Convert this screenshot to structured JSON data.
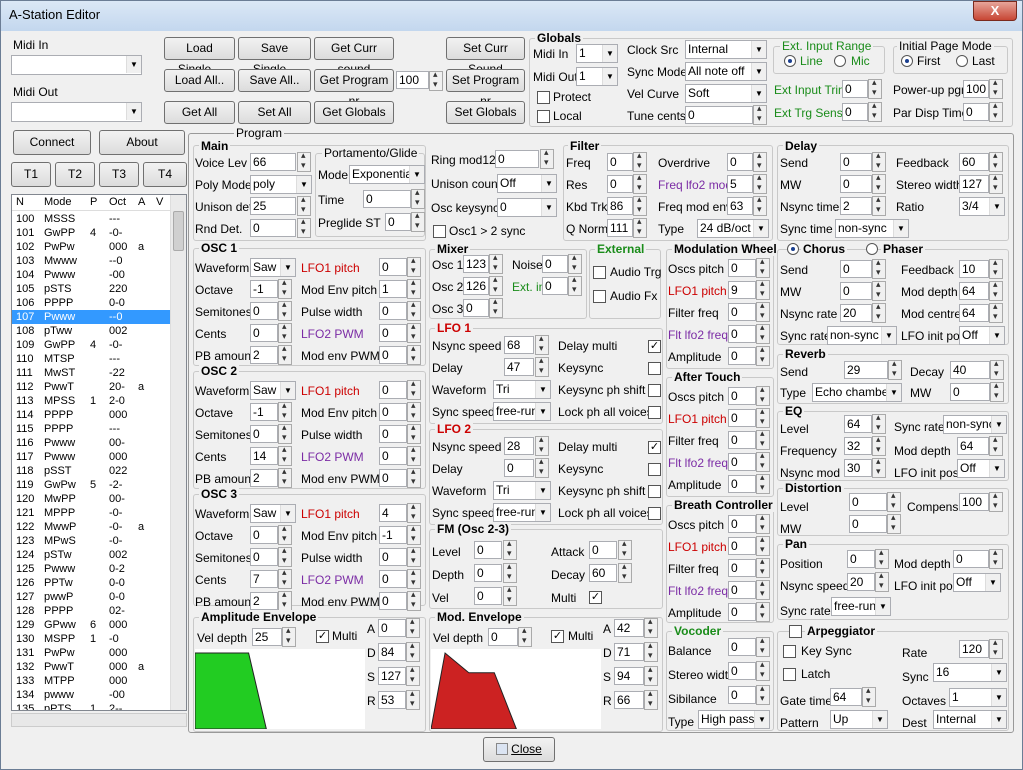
{
  "window": {
    "title": "A-Station Editor",
    "close_glyph": "X"
  },
  "midi": {
    "in_label": "Midi In",
    "out_label": "Midi Out",
    "in_value": "",
    "out_value": ""
  },
  "buttons": {
    "load_single": "Load Single...",
    "save_single": "Save Single...",
    "get_curr_sound": "Get Curr sound",
    "set_curr_sound": "Set Curr Sound",
    "load_all": "Load All..",
    "save_all": "Save All..",
    "get_program_nr": "Get Program nr",
    "program_nr_value": "100",
    "set_program_nr": "Set Program nr",
    "get_all": "Get All",
    "set_all": "Set All",
    "get_globals": "Get Globals",
    "set_globals": "Set Globals",
    "connect": "Connect",
    "about": "About",
    "t1": "T1",
    "t2": "T2",
    "t3": "T3",
    "t4": "T4",
    "close": "Close"
  },
  "globals": {
    "title": "Globals",
    "midi_in_label": "Midi In",
    "midi_in": "1",
    "midi_out_label": "Midi Out",
    "midi_out": "1",
    "protect": "Protect",
    "local": "Local",
    "clock_src_label": "Clock Src",
    "clock_src": "Internal",
    "sync_mode_label": "Sync Mode",
    "sync_mode": "All note off",
    "vel_curve_label": "Vel Curve",
    "vel_curve": "Soft",
    "tune_cents_label": "Tune cents",
    "tune_cents": "0",
    "ext_input_range": "Ext. Input Range",
    "line": "Line",
    "mic": "Mic",
    "ext_input_trim_label": "Ext Input Trim",
    "ext_input_trim": "0",
    "ext_trg_sens_label": "Ext Trg Sens",
    "ext_trg_sens": "0",
    "initial_page_mode": "Initial Page Mode",
    "first": "First",
    "last": "Last",
    "powerup_pgm_label": "Power-up pgm",
    "powerup_pgm": "100",
    "par_disp_time_label": "Par Disp Time",
    "par_disp_time": "0"
  },
  "program_label": "Program",
  "list": {
    "headers": [
      "N",
      "Mode",
      "P",
      "Oct",
      "A",
      "V"
    ],
    "rows": [
      [
        "100",
        "MSSS",
        "",
        "---",
        "",
        ""
      ],
      [
        "101",
        "GwPP",
        "4",
        "-0-",
        "",
        ""
      ],
      [
        "102",
        "PwPw",
        "",
        "000",
        "a",
        ""
      ],
      [
        "103",
        "Mwww",
        "",
        "--0",
        "",
        ""
      ],
      [
        "104",
        "Pwww",
        "",
        "-00",
        "",
        ""
      ],
      [
        "105",
        "pSTS",
        "",
        "220",
        "",
        ""
      ],
      [
        "106",
        "PPPP",
        "",
        "0-0",
        "",
        ""
      ],
      [
        "107",
        "Pwww",
        "",
        "--0",
        "",
        ""
      ],
      [
        "108",
        "pTww",
        "",
        "002",
        "",
        ""
      ],
      [
        "109",
        "GwPP",
        "4",
        "-0-",
        "",
        ""
      ],
      [
        "110",
        "MTSP",
        "",
        "---",
        "",
        ""
      ],
      [
        "111",
        "MwST",
        "",
        "-22",
        "",
        ""
      ],
      [
        "112",
        "PwwT",
        "",
        "20-",
        "a",
        ""
      ],
      [
        "113",
        "MPSS",
        "1",
        "2-0",
        "",
        ""
      ],
      [
        "114",
        "PPPP",
        "",
        "000",
        "",
        ""
      ],
      [
        "115",
        "PPPP",
        "",
        "---",
        "",
        ""
      ],
      [
        "116",
        "Pwww",
        "",
        "00-",
        "",
        ""
      ],
      [
        "117",
        "Pwww",
        "",
        "000",
        "",
        ""
      ],
      [
        "118",
        "pSST",
        "",
        "022",
        "",
        ""
      ],
      [
        "119",
        "GwPw",
        "5",
        "-2-",
        "",
        ""
      ],
      [
        "120",
        "MwPP",
        "",
        "00-",
        "",
        ""
      ],
      [
        "121",
        "MPPP",
        "",
        "-0-",
        "",
        ""
      ],
      [
        "122",
        "MwwP",
        "",
        "-0-",
        "a",
        ""
      ],
      [
        "123",
        "MPwS",
        "",
        "-0-",
        "",
        ""
      ],
      [
        "124",
        "pSTw",
        "",
        "002",
        "",
        ""
      ],
      [
        "125",
        "Pwww",
        "",
        "0-2",
        "",
        ""
      ],
      [
        "126",
        "PPTw",
        "",
        "0-0",
        "",
        ""
      ],
      [
        "127",
        "pwwP",
        "",
        "0-0",
        "",
        ""
      ],
      [
        "128",
        "PPPP",
        "",
        "02-",
        "",
        ""
      ],
      [
        "129",
        "GPww",
        "6",
        "000",
        "",
        ""
      ],
      [
        "130",
        "MSPP",
        "1",
        "-0",
        "",
        ""
      ],
      [
        "131",
        "PwPw",
        "",
        "000",
        "",
        ""
      ],
      [
        "132",
        "PwwT",
        "",
        "000",
        "a",
        ""
      ],
      [
        "133",
        "MTPP",
        "",
        "000",
        "",
        ""
      ],
      [
        "134",
        "pwww",
        "",
        "-00",
        "",
        ""
      ],
      [
        "135",
        "pPTS",
        "1",
        "2--",
        "",
        ""
      ]
    ],
    "selected_index": 7
  },
  "main": {
    "title": "Main",
    "voice_lev_label": "Voice Lev",
    "voice_lev": "66",
    "poly_mode_label": "Poly Mode",
    "poly_mode": "poly",
    "unison_det_label": "Unison det",
    "unison_det": "25",
    "rnd_det_label": "Rnd Det.",
    "rnd_det": "0"
  },
  "porta": {
    "title": "Portamento/Glide",
    "mode_label": "Mode",
    "mode": "Exponential",
    "time_label": "Time",
    "time": "0",
    "preglide_label": "Preglide ST",
    "preglide": "0"
  },
  "ring": {
    "ring_label": "Ring mod12",
    "ring": "0",
    "unison_count_label": "Unison count",
    "unison_count": "Off",
    "osc_keysync_label": "Osc keysync",
    "osc_keysync": "0",
    "osc1_2_sync": "Osc1 > 2 sync"
  },
  "filter": {
    "title": "Filter",
    "freq_label": "Freq",
    "freq": "0",
    "res_label": "Res",
    "res": "0",
    "kbd_trk_label": "Kbd Trk",
    "kbd_trk": "86",
    "q_norm_label": "Q Norm",
    "q_norm": "111",
    "overdrive_label": "Overdrive",
    "overdrive": "0",
    "freq_lfo2_label": "Freq lfo2 mod",
    "freq_lfo2": "5",
    "freq_mod_env_label": "Freq mod env",
    "freq_mod_env": "63",
    "type_label": "Type",
    "type": "24 dB/oct"
  },
  "delay": {
    "title": "Delay",
    "send_label": "Send",
    "send": "0",
    "mw_label": "MW",
    "mw": "0",
    "nsync_label": "Nsync time",
    "nsync": "2",
    "sync_label": "Sync time",
    "sync": "non-sync",
    "feedback_label": "Feedback",
    "feedback": "60",
    "stereo_label": "Stereo width",
    "stereo": "127",
    "ratio_label": "Ratio",
    "ratio": "3/4"
  },
  "osc1": {
    "title": "OSC 1",
    "waveform": "Saw",
    "octave": "-1",
    "semitones": "0",
    "cents": "0",
    "pb_amount": "2",
    "lfo1_pitch": "0",
    "mod_env_pitch": "1",
    "pulse_width": "0",
    "lfo2_pwm": "0",
    "mod_env_pwm": "0"
  },
  "osc2": {
    "title": "OSC 2",
    "waveform": "Saw",
    "octave": "-1",
    "semitones": "0",
    "cents": "14",
    "pb_amount": "2",
    "lfo1_pitch": "0",
    "mod_env_pitch": "0",
    "pulse_width": "0",
    "lfo2_pwm": "0",
    "mod_env_pwm": "0"
  },
  "osc3": {
    "title": "OSC 3",
    "waveform": "Saw",
    "octave": "0",
    "semitones": "0",
    "cents": "7",
    "pb_amount": "2",
    "lfo1_pitch": "4",
    "mod_env_pitch": "-1",
    "pulse_width": "0",
    "lfo2_pwm": "0",
    "mod_env_pwm": "0"
  },
  "osc_labels": {
    "waveform": "Waveform",
    "octave": "Octave",
    "semitones": "Semitones",
    "cents": "Cents",
    "pb_amount": "PB amount",
    "lfo1_pitch": "LFO1 pitch",
    "mod_env_pitch": "Mod Env pitch",
    "pulse_width": "Pulse width",
    "lfo2_pwm": "LFO2 PWM",
    "mod_env_pwm": "Mod env PWM"
  },
  "mixer": {
    "title": "Mixer",
    "osc1_label": "Osc 1",
    "osc1": "123",
    "osc2_label": "Osc 2",
    "osc2": "126",
    "osc3_label": "Osc 3",
    "osc3": "0",
    "noise_label": "Noise",
    "noise": "0",
    "ext_in_label": "Ext. in",
    "ext_in": "0"
  },
  "external": {
    "title": "External",
    "audio_trg": "Audio Trg",
    "audio_fx": "Audio Fx"
  },
  "lfo1": {
    "title": "LFO 1",
    "nsync_label": "Nsync speed",
    "nsync": "68",
    "delay_label": "Delay",
    "delay": "47",
    "waveform_label": "Waveform",
    "waveform": "Tri",
    "sync_label": "Sync speed",
    "sync": "free-run",
    "delay_multi": "Delay multi",
    "keysync": "Keysync",
    "keysync_ph": "Keysync ph shift",
    "lock_ph": "Lock ph all voices"
  },
  "lfo2": {
    "title": "LFO 2",
    "nsync_label": "Nsync speed",
    "nsync": "28",
    "delay_label": "Delay",
    "delay": "0",
    "waveform_label": "Waveform",
    "waveform": "Tri",
    "sync_label": "Sync speed",
    "sync": "free-run",
    "delay_multi": "Delay multi",
    "keysync": "Keysync",
    "keysync_ph": "Keysync ph shift",
    "lock_ph": "Lock ph all voices"
  },
  "fm": {
    "title": "FM (Osc 2-3)",
    "level_label": "Level",
    "level": "0",
    "depth_label": "Depth",
    "depth": "0",
    "vel_label": "Vel",
    "vel": "0",
    "attack_label": "Attack",
    "attack": "0",
    "decay_label": "Decay",
    "decay": "60",
    "multi_label": "Multi"
  },
  "modwheel": {
    "title": "Modulation Wheel",
    "oscs_pitch": "0",
    "lfo1_pitch": "9",
    "filter_freq": "0",
    "flt_lfo2_freq": "0",
    "amplitude": "0"
  },
  "aftertouch": {
    "title": "After Touch",
    "oscs_pitch": "0",
    "lfo1_pitch": "0",
    "filter_freq": "0",
    "flt_lfo2_freq": "0",
    "amplitude": "0"
  },
  "breath": {
    "title": "Breath Controller",
    "oscs_pitch": "0",
    "lfo1_pitch": "0",
    "filter_freq": "0",
    "flt_lfo2_freq": "0",
    "amplitude": "0"
  },
  "mod_labels": {
    "oscs_pitch": "Oscs pitch",
    "lfo1_pitch": "LFO1 pitch",
    "filter_freq": "Filter freq",
    "flt_lfo2_freq": "Flt lfo2 freq",
    "amplitude": "Amplitude"
  },
  "chorus": {
    "chorus_label": "Chorus",
    "phaser_label": "Phaser",
    "send_label": "Send",
    "send": "0",
    "mw_label": "MW",
    "mw": "0",
    "nsync_label": "Nsync rate",
    "nsync": "20",
    "sync_label": "Sync rate",
    "sync": "non-sync",
    "feedback_label": "Feedback",
    "feedback": "10",
    "mod_depth_label": "Mod depth",
    "mod_depth": "64",
    "mod_centre_label": "Mod centre",
    "mod_centre": "64",
    "lfo_init_label": "LFO init pos",
    "lfo_init": "Off"
  },
  "reverb": {
    "title": "Reverb",
    "send_label": "Send",
    "send": "29",
    "decay_label": "Decay",
    "decay": "40",
    "type_label": "Type",
    "type": "Echo chamber",
    "mw_label": "MW",
    "mw": "0"
  },
  "eq": {
    "title": "EQ",
    "level_label": "Level",
    "level": "64",
    "freq_label": "Frequency",
    "freq": "32",
    "nsync_label": "Nsync mod",
    "nsync": "30",
    "sync_rate_label": "Sync rate",
    "sync_rate": "non-sync",
    "mod_depth_label": "Mod depth",
    "mod_depth": "64",
    "lfo_init_label": "LFO init pos",
    "lfo_init": "Off"
  },
  "distortion": {
    "title": "Distortion",
    "level_label": "Level",
    "level": "0",
    "mw_label": "MW",
    "mw": "0",
    "compens_label": "Compens.",
    "compens": "100"
  },
  "pan": {
    "title": "Pan",
    "position_label": "Position",
    "position": "0",
    "nsync_label": "Nsync speed",
    "nsync": "20",
    "sync_label": "Sync rate",
    "sync": "free-run",
    "mod_depth_label": "Mod depth",
    "mod_depth": "0",
    "lfo_init_label": "LFO init pos",
    "lfo_init": "Off"
  },
  "amp_env": {
    "title": "Amplitude Envelope",
    "vel_depth_label": "Vel depth",
    "vel_depth": "25",
    "multi": "Multi",
    "a_label": "A",
    "a": "0",
    "d_label": "D",
    "d": "84",
    "s_label": "S",
    "s": "127",
    "r_label": "R",
    "r": "53",
    "color": "#22cc22"
  },
  "mod_env": {
    "title": "Mod. Envelope",
    "vel_depth_label": "Vel depth",
    "vel_depth": "0",
    "multi": "Multi",
    "a_label": "A",
    "a": "42",
    "d_label": "D",
    "d": "71",
    "s_label": "S",
    "s": "94",
    "r_label": "R",
    "r": "66",
    "color": "#cc2222"
  },
  "vocoder": {
    "title": "Vocoder",
    "balance_label": "Balance",
    "balance": "0",
    "stereo_label": "Stereo width",
    "stereo": "0",
    "sibilance_label": "Sibilance",
    "sibilance": "0",
    "type_label": "Type",
    "type": "High pass"
  },
  "arp": {
    "title": "Arpeggiator",
    "key_sync": "Key Sync",
    "latch": "Latch",
    "gate_label": "Gate time",
    "gate": "64",
    "pattern_label": "Pattern",
    "pattern": "Up",
    "rate_label": "Rate",
    "rate": "120",
    "sync_label": "Sync",
    "sync": "16",
    "octaves_label": "Octaves",
    "octaves": "1",
    "dest_label": "Dest",
    "dest": "Internal"
  }
}
